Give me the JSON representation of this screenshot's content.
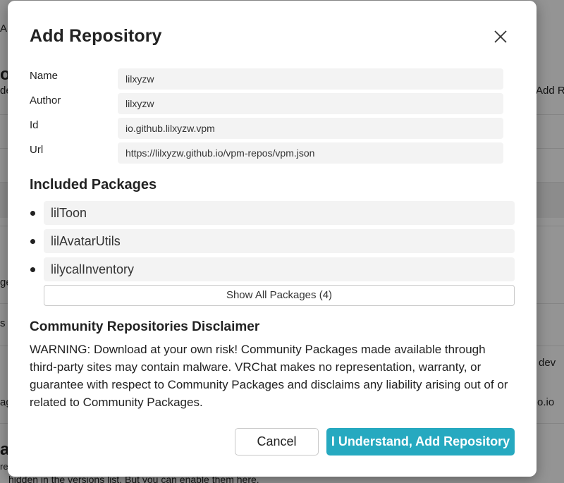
{
  "background": {
    "fragments": [
      "Ap",
      "or",
      "de",
      "Add R",
      "ge",
      "s",
      "dev",
      "ag",
      "o.io",
      "ag",
      "re",
      "hidden in the versions list. But you can enable them here."
    ]
  },
  "modal": {
    "title": "Add Repository",
    "close_icon": "close-icon",
    "fields": [
      {
        "label": "Name",
        "value": "lilxyzw"
      },
      {
        "label": "Author",
        "value": "lilxyzw"
      },
      {
        "label": "Id",
        "value": "io.github.lilxyzw.vpm"
      },
      {
        "label": "Url",
        "value": "https://lilxyzw.github.io/vpm-repos/vpm.json"
      }
    ],
    "packages_title": "Included Packages",
    "packages": [
      "lilToon",
      "lilAvatarUtils",
      "lilycalInventory"
    ],
    "show_all_label": "Show All Packages (4)",
    "disclaimer_title": "Community Repositories Disclaimer",
    "disclaimer_text": "WARNING: Download at your own risk! Community Packages made available through third-party sites may contain malware. VRChat makes no representation, warranty, or guarantee with respect to Community Packages and disclaims any liability arising out of or related to Community Packages.",
    "cancel_label": "Cancel",
    "confirm_label": "I Understand, Add Repository",
    "accent_color": "#26a9c0"
  }
}
